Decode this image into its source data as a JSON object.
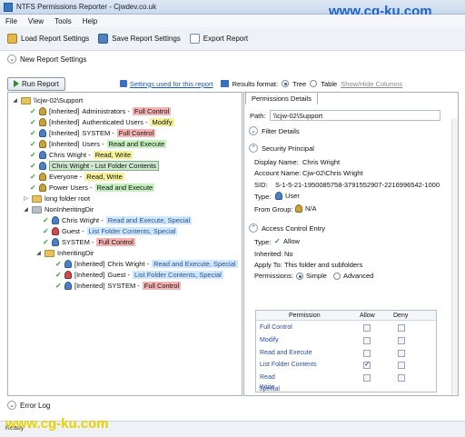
{
  "window": {
    "title": "NTFS Permissions Reporter - Cjwdev.co.uk"
  },
  "watermark": {
    "top": "www.cg-ku.com",
    "bottom": "www.cg-ku.com"
  },
  "menu": [
    "File",
    "View",
    "Tools",
    "Help"
  ],
  "toolbar": {
    "load": "Load Report Settings",
    "save": "Save Report Settings",
    "export": "Export Report"
  },
  "new_report": "New Report Settings",
  "run": {
    "label": "Run Report",
    "settings_link": "Settings used for this report",
    "results_format": "Results format:",
    "tree": "Tree",
    "table": "Table",
    "showhide": "Show/Hide Columns"
  },
  "tree": [
    {
      "prefix": "",
      "name": "\\\\cjw-02\\Support",
      "perm": "",
      "style": ""
    },
    {
      "prefix": "[Inherited] ",
      "name": "Administrators - ",
      "perm": "Full Control",
      "style": "red"
    },
    {
      "prefix": "[Inherited] ",
      "name": "Authenticated Users - ",
      "perm": "Modify",
      "style": "yellow"
    },
    {
      "prefix": "[Inherited] ",
      "name": "SYSTEM - ",
      "perm": "Full Control",
      "style": "red"
    },
    {
      "prefix": "[Inherited] ",
      "name": "Users - ",
      "perm": "Read and Execute",
      "style": "green"
    },
    {
      "prefix": "",
      "name": "Chris Wright - ",
      "perm": "Read, Write",
      "style": "yellow"
    },
    {
      "prefix": "",
      "name": "Chris Wright - ",
      "perm": "List Folder Contents",
      "style": "green"
    },
    {
      "prefix": "",
      "name": "Everyone - ",
      "perm": "Read, Write",
      "style": "yellow"
    },
    {
      "prefix": "",
      "name": "Power Users - ",
      "perm": "Read and Execute",
      "style": "green"
    },
    {
      "prefix": "",
      "name": "long folder root",
      "perm": "",
      "style": ""
    },
    {
      "prefix": "",
      "name": "NonInheritingDir",
      "perm": "",
      "style": ""
    },
    {
      "prefix": "",
      "name": "Chris Wright - ",
      "perm": "Read and Execute, Special",
      "style": "blue"
    },
    {
      "prefix": "",
      "name": "Guest - ",
      "perm": "List Folder Contents, Special",
      "style": "blue"
    },
    {
      "prefix": "",
      "name": "SYSTEM - ",
      "perm": "Full Control",
      "style": "red"
    },
    {
      "prefix": "",
      "name": "InheritingDir",
      "perm": "",
      "style": ""
    },
    {
      "prefix": "[Inherited] ",
      "name": "Chris Wright - ",
      "perm": "Read and Execute, Special",
      "style": "blue"
    },
    {
      "prefix": "[Inherited] ",
      "name": "Guest - ",
      "perm": "List Folder Contents, Special",
      "style": "blue"
    },
    {
      "prefix": "[Inherited] ",
      "name": "SYSTEM - ",
      "perm": "Full Control",
      "style": "red"
    }
  ],
  "details": {
    "tab": "Permissions Details",
    "path_label": "Path:",
    "path": "\\\\cjw-02\\Support",
    "filter": "Filter Details",
    "sp_header": "Security Principal",
    "display_label": "Display Name:",
    "display": "Chris Wright",
    "account_label": "Account Name:",
    "account": "Cjw-02\\Chris Wright",
    "sid_label": "SID:",
    "sid": "S-1-5-21-1950085758-3791552907-2216996542-1000",
    "type_label": "Type:",
    "type": "User",
    "from_label": "From Group:",
    "from": "N/A",
    "ace_header": "Access Control Entry",
    "acetype_label": "Type:",
    "acetype": "Allow",
    "inherited_label": "Inherited:",
    "inherited": "No",
    "apply_label": "Apply To:",
    "apply": "This folder and subfolders",
    "perms_label": "Permissions:",
    "simple": "Simple",
    "advanced": "Advanced"
  },
  "perm_table": {
    "headers": [
      "Permission",
      "Allow",
      "Deny"
    ],
    "rows": [
      {
        "name": "Full Control",
        "allow": false
      },
      {
        "name": "Modify",
        "allow": false
      },
      {
        "name": "Read and Execute",
        "allow": false
      },
      {
        "name": "List Folder Contents",
        "allow": true
      },
      {
        "name": "Read",
        "allow": false
      },
      {
        "name": "Write",
        "allow": false
      },
      {
        "name": "Special",
        "allow": false
      }
    ]
  },
  "error_log": "Error Log",
  "status": "Ready"
}
